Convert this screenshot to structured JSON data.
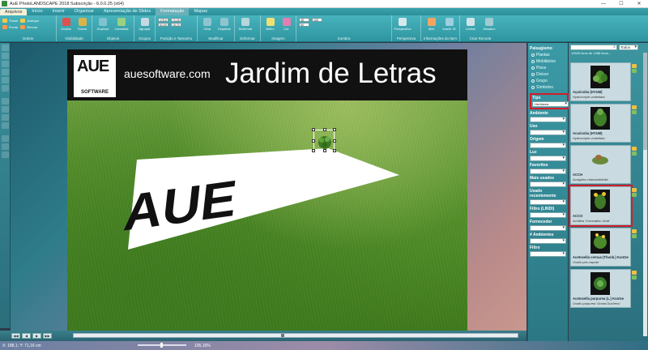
{
  "window": {
    "title": "AuE PhotoLANDSCAPE 2018 Subscrição - 6.0.0.25 (x64)",
    "minimize": "—",
    "maximize": "☐",
    "close": "✕"
  },
  "menu": {
    "tabs": [
      "Arquivos",
      "Início",
      "Inserir",
      "Organizar",
      "Apresentação de Slides",
      "Formatação",
      "Mapas"
    ]
  },
  "ribbon": {
    "groups": [
      {
        "label": "Ordem",
        "buttons": [
          "Trazer",
          "Enviar",
          "Avançar",
          "Recuar"
        ]
      },
      {
        "label": "Visibilidade",
        "buttons": [
          "Ocultar",
          "Travar"
        ]
      },
      {
        "label": "Objetos",
        "buttons": [
          "Duplicar",
          "Camadas"
        ]
      },
      {
        "label": "Grupos",
        "buttons": [
          "Agrupar"
        ]
      },
      {
        "label": "Posição e Tamanho",
        "fields": [
          "179,0",
          "52,00",
          "71,15",
          "15,70"
        ]
      },
      {
        "label": "Modificar",
        "buttons": [
          "Girar",
          "Espelhar"
        ]
      },
      {
        "label": "Deformar",
        "buttons": [
          "Deformar"
        ]
      },
      {
        "label": "Imagem",
        "buttons": [
          "Brilho",
          "Cor"
        ]
      },
      {
        "label": "Sombra",
        "fields": [
          "45",
          "50",
          "100"
        ]
      },
      {
        "label": "Perspectiva",
        "buttons": [
          "Perspectiva"
        ]
      },
      {
        "label": "Informações do Item",
        "buttons": [
          "Item",
          "Inserir ID"
        ]
      },
      {
        "label": "Criar Recorte",
        "buttons": [
          "Limitar",
          "Mosaico"
        ]
      }
    ]
  },
  "canvas": {
    "brand_site": "auesoftware.com",
    "headline": "Jardim de Letras",
    "logo_text": "AUE",
    "logo_sub": "SOFTWARE",
    "letters_on_lawn": "AUE"
  },
  "timeline": {
    "buttons": [
      "◀◀",
      "◀",
      "▶",
      "▶▶"
    ]
  },
  "status": {
    "coords": "X: 188,1; Y: 71,16 cm",
    "zoom": "105,16%"
  },
  "filters": {
    "paisagismo_label": "Paisagismo",
    "paisagismo_options": [
      "Plantas",
      "Mobiliários",
      "Pisos",
      "Divisor",
      "Grupo",
      "Símbolos"
    ],
    "tipo_label": "Tipo",
    "tipo_value": "Herbácea",
    "categories": [
      "Ambiente",
      "Uso",
      "Origem",
      "Luz",
      "Favoritos",
      "Mais usados",
      "Usado recentemente",
      "Filtro (LINDI)",
      "Fornecedor",
      "# Ambientes",
      "Filtro"
    ]
  },
  "plants": {
    "search_placeholder": "",
    "scope": "Todos",
    "count_text": "10526 itens de 1288 itens...",
    "items": [
      {
        "name": "Açaricoba (HYUM)",
        "sci": "Hydrocotyle umbellata"
      },
      {
        "name": "Acaricoba (HYUM)",
        "sci": "Hydrocotyle umbellata"
      },
      {
        "name": "ACCH",
        "sci": "Acalypha chamaedrifolia"
      },
      {
        "name": "ACCO",
        "sci": "Achillea 'Coronation Gold'"
      },
      {
        "name": "Acetosella cernua (Thunb.) Kuntze",
        "sci": "Oxalis pes-caprae"
      },
      {
        "name": "Acetosella purpurea (L.) Kuntze",
        "sci": "Oxalis purpurea 'Grand Duchess'"
      }
    ]
  },
  "colors": {
    "accent_red": "#d31c2a",
    "ribbon_teal": "#2e95a0"
  }
}
